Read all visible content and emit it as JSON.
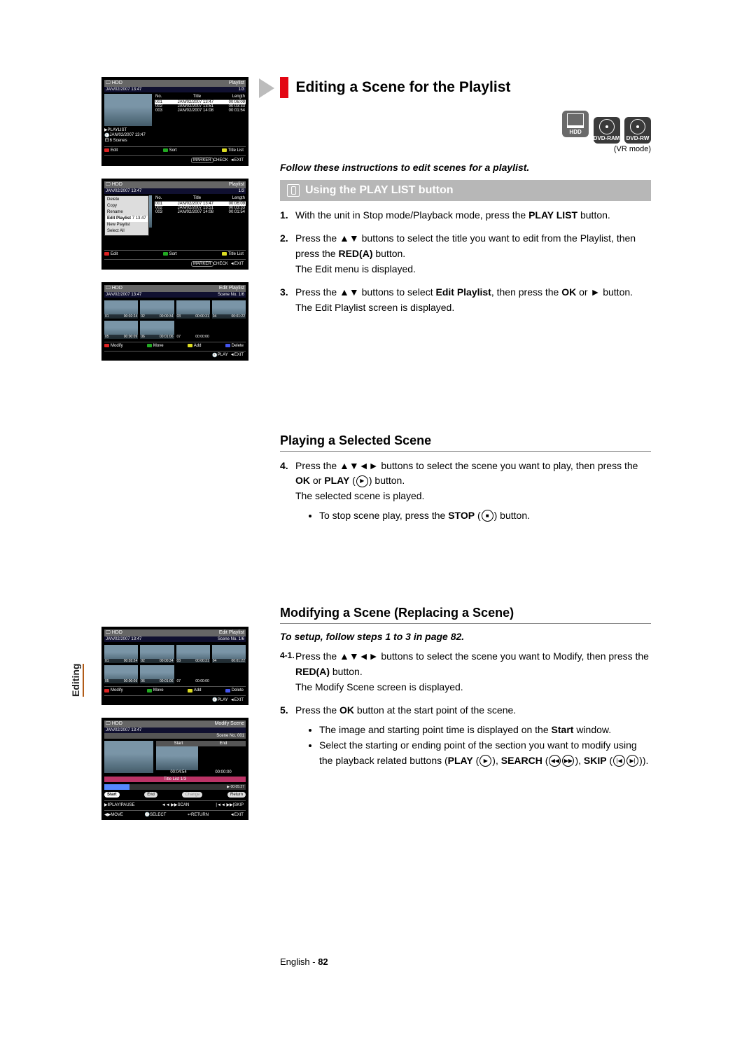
{
  "heading": "Editing a Scene for the Playlist",
  "discs": {
    "hdd": "HDD",
    "ram": "DVD-RAM",
    "rw": "DVD-RW",
    "vr": "(VR mode)"
  },
  "intro": "Follow these instructions to edit scenes for a playlist.",
  "playlist_button_heading": "Using the PLAY LIST button",
  "steps1": [
    {
      "n": "1.",
      "text": "With the unit in Stop mode/Playback mode, press the ",
      "bold1": "PLAY LIST",
      "tail1": " button."
    },
    {
      "n": "2.",
      "text": "Press the ▲▼ buttons to select the title you want to edit from the Playlist, then press the ",
      "bold1": "RED(A)",
      "tail1": " button.\nThe Edit menu is displayed."
    },
    {
      "n": "3.",
      "text": "Press the ▲▼ buttons to select ",
      "bold1": "Edit Playlist",
      "tail1": ", then press the ",
      "bold2": "OK",
      "tail2": " or ► button.\nThe Edit Playlist screen is displayed."
    }
  ],
  "playing_heading": "Playing a Selected Scene",
  "steps2": [
    {
      "n": "4.",
      "part1": "Press the ▲▼◄► buttons to select the scene you want to play, then press the ",
      "b1": "OK",
      "mid": " or ",
      "b2": "PLAY",
      "part2": " button.\nThe selected scene is played.",
      "bullet": "To stop scene play, press the ",
      "bullet_b": "STOP",
      "bullet_tail": " button."
    }
  ],
  "modify_heading": "Modifying a Scene (Replacing a Scene)",
  "setup_note": "To setup, follow steps 1 to 3 in page 82.",
  "steps3": [
    {
      "n": "4-1.",
      "t1": "Press the ▲▼◄► buttons to select the scene you want to Modify, then press the ",
      "b1": "RED(A)",
      "t2": " button.\nThe Modify Scene screen is displayed."
    },
    {
      "n": "5.",
      "t1": "Press the ",
      "b1": "OK",
      "t2": " button at the start point of the scene.",
      "bul1": "The image and starting point time is displayed on the ",
      "bul1b": "Start",
      "bul1t": " window.",
      "bul2": "Select the starting or ending point of the section you want to modify using the playback related buttons (",
      "bul2b1": "PLAY",
      "bul2m1": ", ",
      "bul2b2": "SEARCH",
      "bul2m2": ", ",
      "bul2b3": "SKIP",
      "bul2t": ")."
    }
  ],
  "ui": {
    "hdd": "HDD",
    "playlist": "Playlist",
    "datetime": "JAN/02/2007 13:47",
    "ratio": "1/3",
    "th_no": "No.",
    "th_title": "Title",
    "th_len": "Length",
    "rows": [
      {
        "no": "001",
        "title": "JAN/02/2007 13:47",
        "len": "00:06:09"
      },
      {
        "no": "002",
        "title": "JAN/02/2007 13:51",
        "len": "00:03:33"
      },
      {
        "no": "003",
        "title": "JAN/02/2007 14:08",
        "len": "00:01:54"
      }
    ],
    "meta": {
      "l1": "PLAYLIST",
      "l2": "JAN/02/2007 13:47",
      "l3": "6 Scenes"
    },
    "foot": {
      "edit": "Edit",
      "sort": "Sort",
      "title_list": "Title List",
      "check": "CHECK",
      "exit": "EXIT"
    },
    "ctx": [
      "Delete",
      "Copy",
      "Rename",
      "Edit Playlist",
      "New Playlist",
      "Select All"
    ],
    "ctx_hl": "Edit Playlist",
    "ctx_tail": "7 13:47",
    "edit_pl": "Edit Playlist",
    "scene_no": "Scene No. 1/6",
    "scenes": [
      {
        "n": "01",
        "t": "00:02:24"
      },
      {
        "n": "02",
        "t": "00:00:34"
      },
      {
        "n": "03",
        "t": "00:00:31"
      },
      {
        "n": "04",
        "t": "00:01:22"
      },
      {
        "n": "05",
        "t": "00:00:09"
      },
      {
        "n": "06",
        "t": "00:01:06"
      },
      {
        "n": "07",
        "t": "00:00:00"
      }
    ],
    "foot2": {
      "modify": "Modify",
      "move": "Move",
      "add": "Add",
      "delete": "Delete",
      "play": "PLAY"
    },
    "modify_scene": "Modify Scene",
    "scene_no2": "Scene No. 001",
    "title_list_bar": "Title List 1/3",
    "start": "Start",
    "end": "End",
    "t_start": "00:04:54",
    "t_end": "00:00:00",
    "t_bar": "00:05:27",
    "btn_start": "Start",
    "btn_end": "End",
    "btn_change": "Change",
    "btn_return": "Return",
    "foot3": {
      "play": "PLAY/PAUSE",
      "scan": "SCAN",
      "skip": "SKIP",
      "move": "MOVE",
      "select": "SELECT",
      "return": "RETURN",
      "exit": "EXIT"
    }
  },
  "side_tab": "Editing",
  "footer": {
    "lang": "English",
    "sep": " - ",
    "page": "82"
  }
}
